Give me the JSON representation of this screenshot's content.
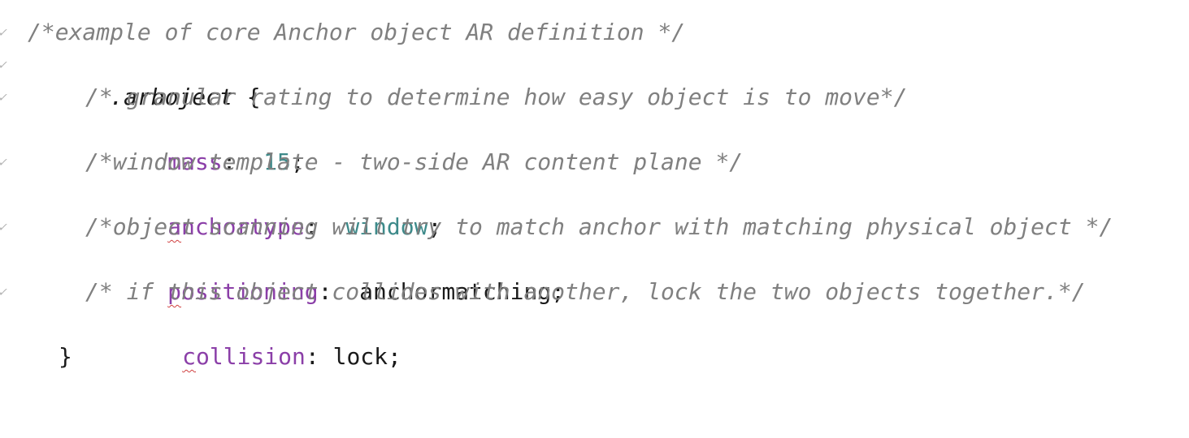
{
  "code": {
    "line1": {
      "comment": "/*example of core Anchor object AR definition */"
    },
    "line2": {
      "selector": ".arboject",
      "brace": " {"
    },
    "line3": {
      "comment": "/* granular rating to determine how easy object is to move*/"
    },
    "line4": {
      "property": "mass",
      "colon": ":  ",
      "value": "15",
      "semi": ";"
    },
    "line5": {
      "comment": "/*window template - two-side AR content plane */"
    },
    "line6": {
      "property_first": "a",
      "property_rest": "nchortype",
      "colon": ":  ",
      "value": "window",
      "semi": ";"
    },
    "line7": {
      "comment": "/*object scanning will try to match anchor with matching physical object */"
    },
    "line8": {
      "property_first": "p",
      "property_rest": "ositioning",
      "colon": ":  ",
      "value": "anchormatching;"
    },
    "line9": {
      "comment": "/* if this object collides with another, lock the two objects together.*/"
    },
    "line10": {
      "property_first": "c",
      "property_rest": "ollision",
      "colon": ": ",
      "value": "lock;"
    },
    "line11": {
      "brace": "}"
    }
  },
  "fold_mark": "✓"
}
